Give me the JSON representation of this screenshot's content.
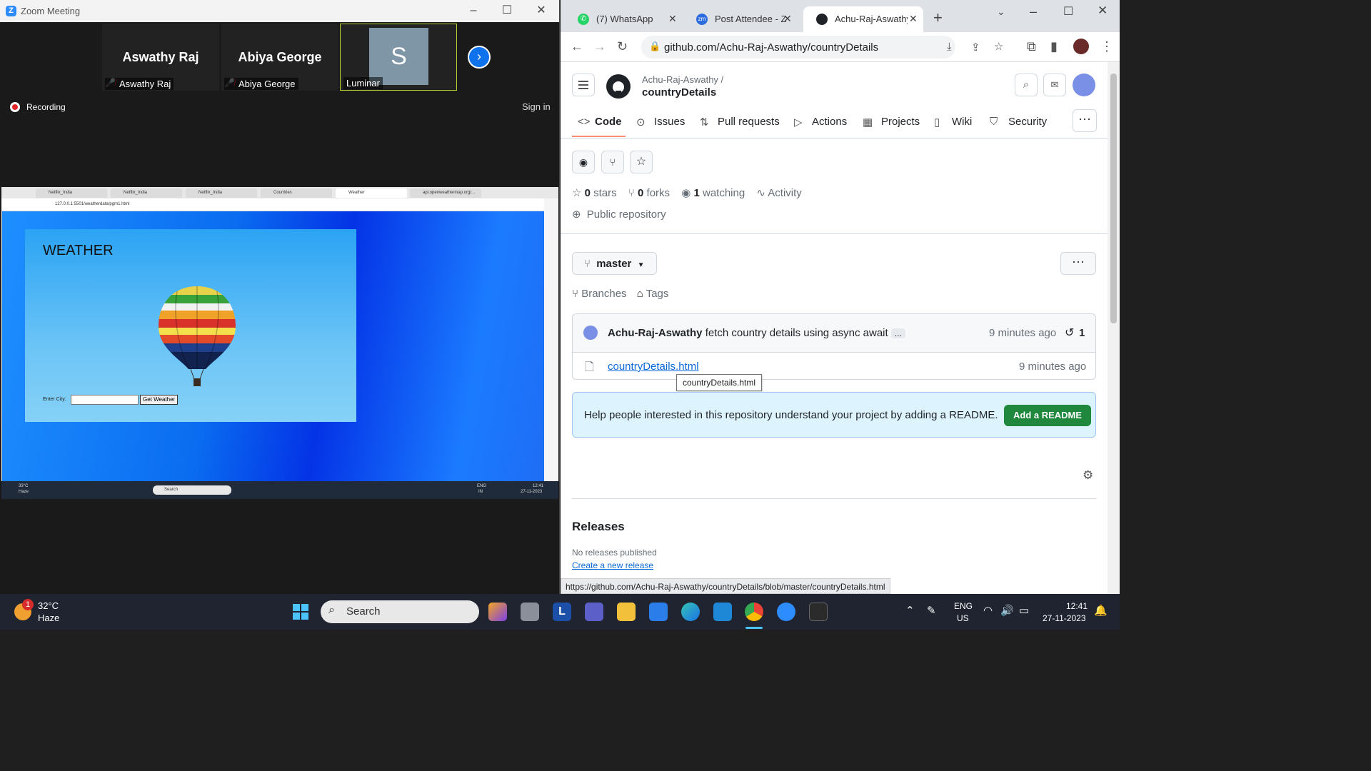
{
  "zoom": {
    "window_title": "Zoom Meeting",
    "participants": [
      {
        "big_name": "Aswathy Raj",
        "label": "Aswathy Raj"
      },
      {
        "big_name": "Abiya George",
        "label": "Abiya George"
      },
      {
        "avatar_letter": "S",
        "label": "Luminar"
      }
    ],
    "recording_label": "Recording",
    "sign_in_label": "Sign in"
  },
  "shared_screen": {
    "tabs": [
      "Netflix_India",
      "Netflix_India",
      "Netflix_India",
      "Countries",
      "Weather",
      "api.openweathermap.org/..."
    ],
    "url": "127.0.0.1:5501/weatherdata/pgm1.html",
    "weather_title": "WEATHER",
    "city_label": "Enter City:",
    "button_label": "Get Weather",
    "taskbar": {
      "temp": "33°C",
      "condition": "Haze",
      "search": "Search",
      "lang": "ENG",
      "region": "IN",
      "time": "12:41",
      "date": "27-11-2023"
    }
  },
  "chrome": {
    "tabs": [
      {
        "label": "(7) WhatsApp",
        "color": "#25d366",
        "icon_text": "✆"
      },
      {
        "label": "Post Attendee - Z",
        "color": "#2d6cdf",
        "icon_text": "zm"
      },
      {
        "label": "Achu-Raj-Aswathy",
        "color": "#1f2328",
        "icon_text": ""
      }
    ],
    "url": "github.com/Achu-Raj-Aswathy/countryDetails",
    "status_url": "https://github.com/Achu-Raj-Aswathy/countryDetails/blob/master/countryDetails.html"
  },
  "github": {
    "owner": "Achu-Raj-Aswathy /",
    "repo": "countryDetails",
    "nav": [
      "Code",
      "Issues",
      "Pull requests",
      "Actions",
      "Projects",
      "Wiki",
      "Security"
    ],
    "stats": {
      "stars_count": "0",
      "stars_label": "stars",
      "forks_count": "0",
      "forks_label": "forks",
      "watching_count": "1",
      "watching_label": "watching",
      "activity_label": "Activity"
    },
    "visibility": "Public repository",
    "branch": "master",
    "branches_label": "Branches",
    "tags_label": "Tags",
    "commit": {
      "author": "Achu-Raj-Aswathy",
      "message": "fetch country details using async await",
      "ellipsis": "...",
      "time": "9 minutes ago",
      "count": "1"
    },
    "file": {
      "name": "countryDetails.html",
      "time": "9 minutes ago",
      "tooltip": "countryDetails.html"
    },
    "readme_prompt": "Help people interested in this repository understand your project by adding a README.",
    "add_readme_label": "Add a README",
    "releases_title": "Releases",
    "no_releases": "No releases published",
    "create_release": "Create a new release",
    "accent": "#1f883d",
    "link_color": "#0969da"
  },
  "taskbar": {
    "weather_temp": "32°C",
    "weather_condition": "Haze",
    "badge_count": "1",
    "search_label": "Search",
    "lang": "ENG",
    "region": "US",
    "time": "12:41",
    "date": "27-11-2023"
  }
}
